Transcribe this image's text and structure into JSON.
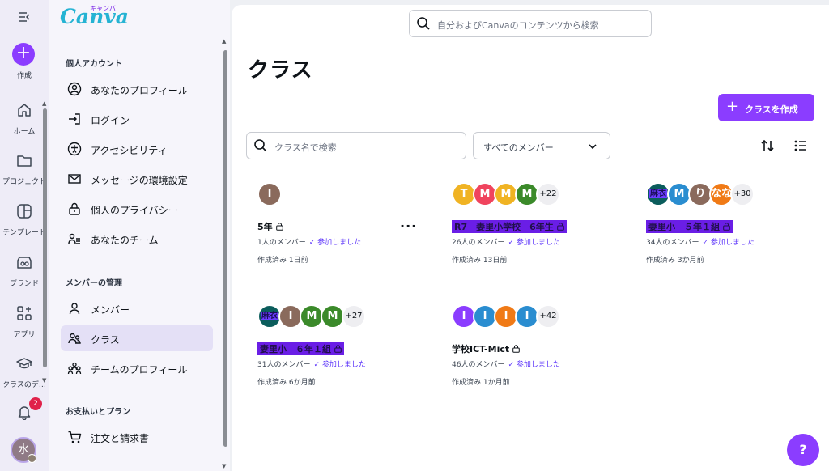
{
  "rail": {
    "create_label": "作成",
    "items": [
      {
        "label": "ホーム",
        "icon": "home-icon"
      },
      {
        "label": "プロジェクト",
        "icon": "folder-icon"
      },
      {
        "label": "テンプレート",
        "icon": "template-icon"
      },
      {
        "label": "ブランド",
        "icon": "brand-icon"
      },
      {
        "label": "アプリ",
        "icon": "apps-icon"
      },
      {
        "label": "クラスのデ…",
        "icon": "graduation-cap-icon"
      }
    ],
    "notification_count": "2",
    "avatar_initial": "水"
  },
  "sidebar": {
    "logo": "Canva",
    "logo_kana": "キャンバ",
    "sections": [
      {
        "title": "個人アカウント",
        "items": [
          {
            "label": "あなたのプロフィール",
            "icon": "profile-icon"
          },
          {
            "label": "ログイン",
            "icon": "login-icon"
          },
          {
            "label": "アクセシビリティ",
            "icon": "accessibility-icon"
          },
          {
            "label": "メッセージの環境設定",
            "icon": "mail-icon"
          },
          {
            "label": "個人のプライバシー",
            "icon": "privacy-lock-icon"
          },
          {
            "label": "あなたのチーム",
            "icon": "team-icon"
          }
        ]
      },
      {
        "title": "メンバーの管理",
        "items": [
          {
            "label": "メンバー",
            "icon": "member-icon"
          },
          {
            "label": "クラス",
            "icon": "class-icon",
            "active": true
          },
          {
            "label": "チームのプロフィール",
            "icon": "team-profile-icon"
          }
        ]
      },
      {
        "title": "お支払いとプラン",
        "items": [
          {
            "label": "注文と請求書",
            "icon": "cart-icon"
          }
        ]
      }
    ]
  },
  "header": {
    "search_placeholder": "自分およびCanvaのコンテンツから検索"
  },
  "main": {
    "title": "クラス",
    "create_button": "クラスを作成",
    "class_search_placeholder": "クラス名で検索",
    "member_filter": "すべてのメンバー",
    "classes": [
      {
        "name": "5年",
        "members": "1人のメンバー",
        "joined": "参加しました",
        "created": "作成済み 1日前",
        "avatars": [
          {
            "t": "I",
            "c": "#8a6a5c"
          }
        ],
        "more": ""
      },
      {
        "name": "R7　妻里小学校　6年生",
        "members": "26人のメンバー",
        "joined": "参加しました",
        "created": "作成済み 13日前",
        "avatars": [
          {
            "t": "T",
            "c": "#f0b323"
          },
          {
            "t": "M",
            "c": "#f0445e"
          },
          {
            "t": "M",
            "c": "#f0b323"
          },
          {
            "t": "M",
            "c": "#3b8a2a"
          }
        ],
        "more": "+22"
      },
      {
        "name": "妻里小　５年１組",
        "members": "34人のメンバー",
        "joined": "参加しました",
        "created": "作成済み 3か月前",
        "avatars": [
          {
            "t": "麻衣",
            "c": "img"
          },
          {
            "t": "M",
            "c": "#2a8dd0"
          },
          {
            "t": "り",
            "c": "#8a6a5c"
          },
          {
            "t": "なな",
            "c": "#f07a16"
          }
        ],
        "more": "+30"
      },
      {
        "name": "妻里小　６年１組",
        "members": "31人のメンバー",
        "joined": "参加しました",
        "created": "作成済み 6か月前",
        "avatars": [
          {
            "t": "麻衣",
            "c": "img"
          },
          {
            "t": "I",
            "c": "#8a6a5c"
          },
          {
            "t": "M",
            "c": "#3b8a2a"
          },
          {
            "t": "M",
            "c": "#3b8a2a"
          }
        ],
        "more": "+27"
      },
      {
        "name": "学校ICT-Mict",
        "members": "46人のメンバー",
        "joined": "参加しました",
        "created": "作成済み 1か月前",
        "avatars": [
          {
            "t": "I",
            "c": "#8b3dff"
          },
          {
            "t": "I",
            "c": "#2a8dd0"
          },
          {
            "t": "I",
            "c": "#f07a16"
          },
          {
            "t": "I",
            "c": "#2a8dd0"
          }
        ],
        "more": "+42"
      }
    ]
  },
  "help_label": "?",
  "colors": {
    "accent": "#8b3dff",
    "joined_text": "#5a32fa",
    "badge": "#e0224a"
  }
}
